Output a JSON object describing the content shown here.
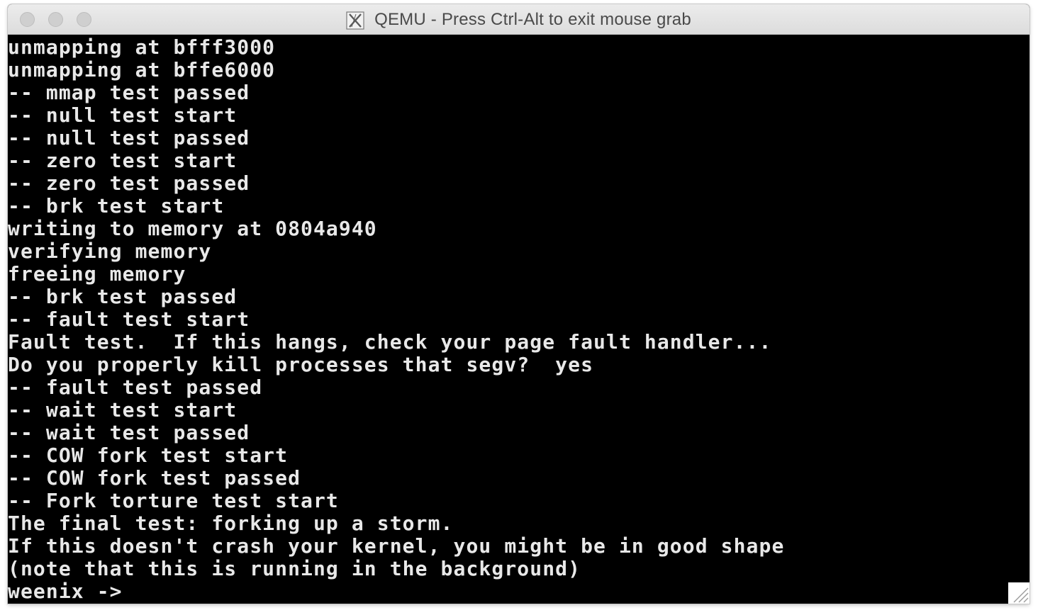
{
  "window": {
    "title": "QEMU - Press Ctrl-Alt to exit mouse grab",
    "title_icon": "x11-icon",
    "controls": [
      "close-button",
      "minimize-button",
      "zoom-button"
    ]
  },
  "console": {
    "lines": [
      "unmapping at bfff3000",
      "unmapping at bffe6000",
      "-- mmap test passed",
      "-- null test start",
      "-- null test passed",
      "-- zero test start",
      "-- zero test passed",
      "-- brk test start",
      "writing to memory at 0804a940",
      "verifying memory",
      "freeing memory",
      "-- brk test passed",
      "-- fault test start",
      "Fault test.  If this hangs, check your page fault handler...",
      "Do you properly kill processes that segv?  yes",
      "-- fault test passed",
      "-- wait test start",
      "-- wait test passed",
      "-- COW fork test start",
      "-- COW fork test passed",
      "-- Fork torture test start",
      "The final test: forking up a storm.",
      "If this doesn't crash your kernel, you might be in good shape",
      "(note that this is running in the background)",
      "weenix ->"
    ]
  },
  "colors": {
    "terminal_bg": "#000000",
    "terminal_fg": "#e8e8e8",
    "titlebar_bg": "#e3e3e3",
    "title_fg": "#4a4a4a",
    "traffic_light_inactive": "#cfcfcf"
  }
}
